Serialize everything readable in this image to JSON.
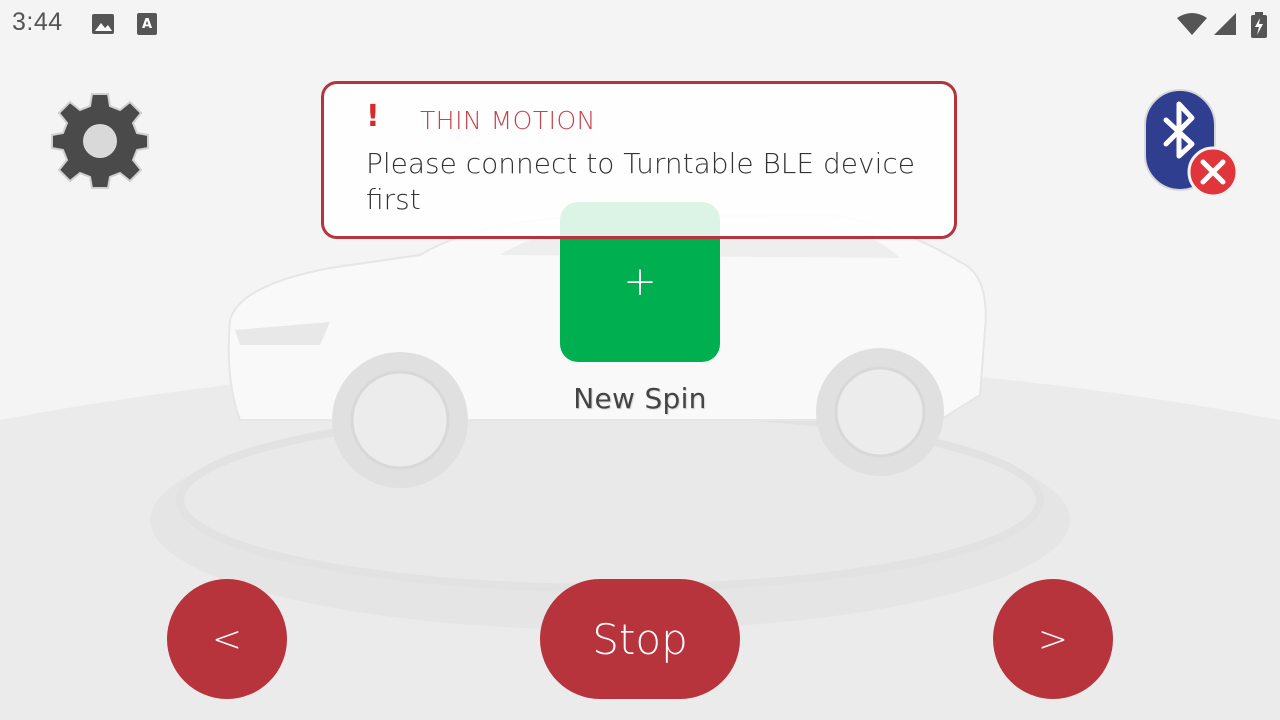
{
  "status_bar": {
    "time": "3:44",
    "left_icons": [
      "image-icon",
      "keyboard-a-icon"
    ],
    "right_icons": [
      "wifi-icon",
      "signal-icon",
      "battery-icon"
    ]
  },
  "alert": {
    "title": "THIN MOTION",
    "message": "Please connect to Turntable BLE device first",
    "icon": "exclamation-icon",
    "border_color": "#b5343d",
    "title_color": "#c7424b"
  },
  "new_spin": {
    "glyph": "+",
    "label": "New Spin",
    "tile_color": "#00b050"
  },
  "controls": {
    "prev_label": "<",
    "stop_label": "Stop",
    "next_label": ">",
    "button_color": "#b8343d"
  },
  "settings": {
    "icon": "gear-icon"
  },
  "bluetooth": {
    "icon": "bluetooth-icon",
    "status_icon": "disconnected-x-icon",
    "status_color": "#e0363b"
  }
}
